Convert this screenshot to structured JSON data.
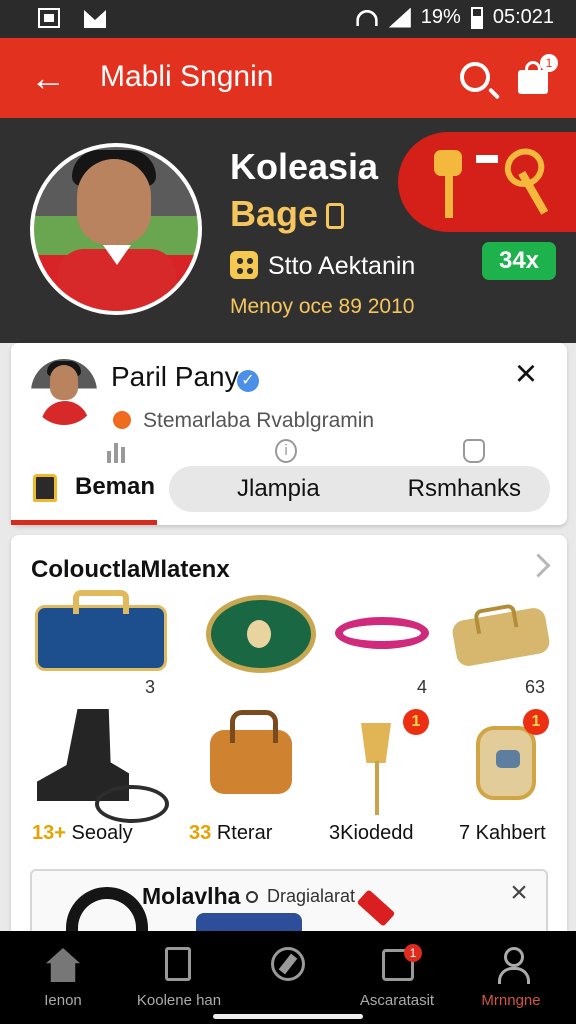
{
  "status_bar": {
    "battery": "19%",
    "time": "05:021"
  },
  "header": {
    "title": "Mabli Sngnin",
    "bag_badge": "1"
  },
  "profile": {
    "collection_title": "Koleasia",
    "badge_title": "Bage",
    "meta_text": "Stto Aektanin",
    "date_text": "Menoy oce 89 2010",
    "count_button": "34x",
    "colors": {
      "header_red": "#e3311f",
      "gold": "#f6c65e",
      "green": "#1db24c"
    }
  },
  "user_card": {
    "name": "Paril Pany",
    "subtitle": "Stemarlaba Rvablgramin",
    "tabs": [
      {
        "label": "Beman",
        "active": true
      },
      {
        "label": "Jlampia",
        "active": false
      },
      {
        "label": "Rsmhanks",
        "active": false
      }
    ]
  },
  "catalog": {
    "title": "ColouctlaMlatenx",
    "items": [
      {
        "count": "3"
      },
      {
        "count": ""
      },
      {
        "count": "4"
      },
      {
        "count": "63"
      },
      {
        "number": "13+",
        "label": "Seoaly"
      },
      {
        "number": "33",
        "label": "Rterar"
      },
      {
        "number": "",
        "label": "3Kiodedd",
        "badge": "1"
      },
      {
        "number": "",
        "label": "7 Kahbert",
        "badge": "1"
      }
    ]
  },
  "popup": {
    "title": "Molavlha",
    "subtitle": "Dragialarat"
  },
  "bottom_nav": [
    {
      "label": "Ienon",
      "icon": "home-icon"
    },
    {
      "label": "Koolene han",
      "icon": "document-icon"
    },
    {
      "label": "",
      "icon": "compass-icon"
    },
    {
      "label": "Ascaratasit",
      "icon": "inbox-icon",
      "badge": "1"
    },
    {
      "label": "Mrnngne",
      "icon": "person-icon",
      "active": true
    }
  ]
}
